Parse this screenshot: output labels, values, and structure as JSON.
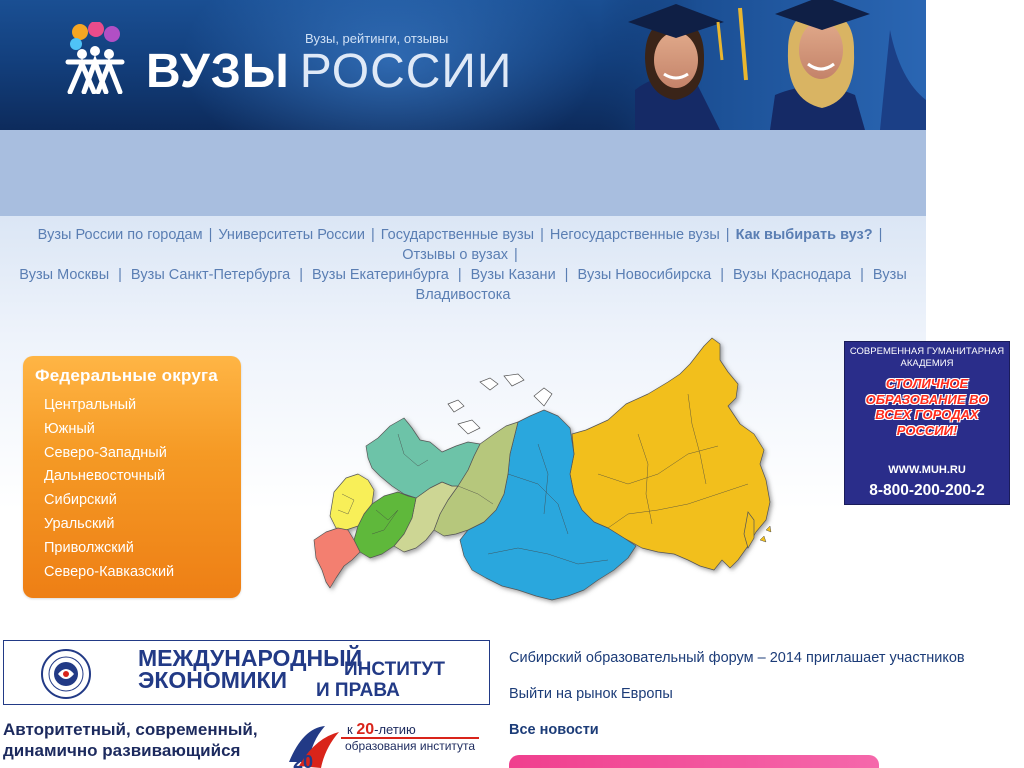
{
  "header": {
    "title_part1": "ВУЗЫ",
    "title_part2": "РОССИИ",
    "tagline": "Вузы, рейтинги, отзывы"
  },
  "nav": {
    "line1": [
      {
        "label": "Вузы России по городам",
        "bold": false
      },
      {
        "label": "Университеты России",
        "bold": false
      },
      {
        "label": "Государственные вузы",
        "bold": false
      },
      {
        "label": "Негосударственные вузы",
        "bold": false
      },
      {
        "label": "Как выбирать вуз?",
        "bold": true
      }
    ],
    "line2_label": "Отзывы о вузах",
    "line3": [
      "Вузы Москвы",
      "Вузы Санкт-Петербурга",
      "Вузы Екатеринбурга",
      "Вузы Казани",
      "Вузы Новосибирска",
      "Вузы Краснодара",
      "Вузы"
    ],
    "line4_label": "Владивостока",
    "separator": "|"
  },
  "districts": {
    "title": "Федеральные округа",
    "items": [
      "Центральный",
      "Южный",
      "Северо-Западный",
      "Дальневосточный",
      "Сибирский",
      "Уральский",
      "Приволжский",
      "Северо-Кавказский"
    ]
  },
  "map_regions": {
    "colors": {
      "far_east": "#f2bf1a",
      "siberia": "#29a7dd",
      "ural": "#b6c77c",
      "volga": "#cdd694",
      "central": "#5fb83a",
      "northwest": "#6dc3a8",
      "south": "#f8ef58",
      "north_caucasus": "#f37f6f"
    }
  },
  "ad_right": {
    "head": "СОВРЕМЕННАЯ ГУМАНИТАРНАЯ АКАДЕМИЯ",
    "slogan": "СТОЛИЧНОЕ ОБРАЗОВАНИЕ ВО ВСЕХ ГОРОДАХ РОССИИ!",
    "url": "WWW.MUH.RU",
    "phone": "8-800-200-200-2"
  },
  "ad_miep": {
    "line1": "МЕЖДУНАРОДНЫЙ",
    "line1b": "ИНСТИТУТ",
    "line2": "ЭКОНОМИКИ",
    "line2b": "И ПРАВА"
  },
  "promo": {
    "text": "Авторитетный, современный, динамично развивающийся",
    "anniv_prefix": "к",
    "anniv_number": "20",
    "anniv_suffix": "-летию",
    "anniv_line2": "образования института"
  },
  "news": {
    "items": [
      "Сибирский образовательный форум – 2014 приглашает участников",
      "Выйти на рынок Европы"
    ],
    "all_label": "Все новости"
  }
}
